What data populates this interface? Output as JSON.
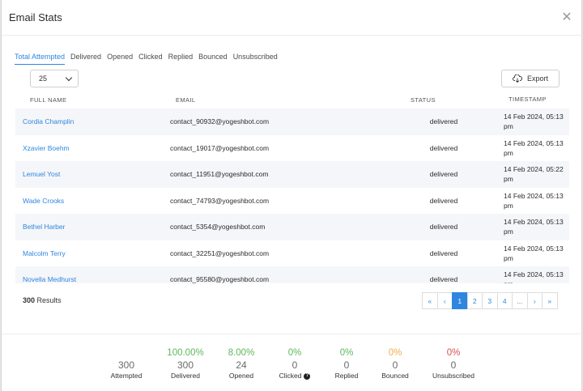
{
  "modal": {
    "title": "Email Stats"
  },
  "tabs": [
    "Total Attempted",
    "Delivered",
    "Opened",
    "Clicked",
    "Replied",
    "Bounced",
    "Unsubscribed"
  ],
  "page_size": {
    "selected": "25"
  },
  "export_label": "Export",
  "columns": [
    "FULL NAME",
    "EMAIL",
    "STATUS",
    "TIMESTAMP"
  ],
  "rows": [
    {
      "name": "Cordia Champlin",
      "email": "contact_90932@yogeshbot.com",
      "status": "delivered",
      "ts1": "14 Feb 2024, 05:13",
      "ts2": "pm"
    },
    {
      "name": "Xzavier Boehm",
      "email": "contact_19017@yogeshbot.com",
      "status": "delivered",
      "ts1": "14 Feb 2024, 05:13",
      "ts2": "pm"
    },
    {
      "name": "Lemuel Yost",
      "email": "contact_11951@yogeshbot.com",
      "status": "delivered",
      "ts1": "14 Feb 2024, 05:22",
      "ts2": "pm"
    },
    {
      "name": "Wade Crooks",
      "email": "contact_74793@yogeshbot.com",
      "status": "delivered",
      "ts1": "14 Feb 2024, 05:13",
      "ts2": "pm"
    },
    {
      "name": "Bethel Harber",
      "email": "contact_5354@yogeshbot.com",
      "status": "delivered",
      "ts1": "14 Feb 2024, 05:13",
      "ts2": "pm"
    },
    {
      "name": "Malcolm Terry",
      "email": "contact_32251@yogeshbot.com",
      "status": "delivered",
      "ts1": "14 Feb 2024, 05:13",
      "ts2": "pm"
    },
    {
      "name": "Novella Medhurst",
      "email": "contact_95580@yogeshbot.com",
      "status": "delivered",
      "ts1": "14 Feb 2024, 05:13",
      "ts2": "pm"
    }
  ],
  "results": {
    "count": "300",
    "label": "Results"
  },
  "pagination": {
    "first": "«",
    "prev": "‹",
    "pages": [
      "1",
      "2",
      "3",
      "4"
    ],
    "ellipsis": "...",
    "next": "›",
    "last": "»",
    "current": "1"
  },
  "stats": [
    {
      "pct": "",
      "count": "300",
      "label": "Attempted",
      "color": "#6b6b6b"
    },
    {
      "pct": "100.00%",
      "count": "300",
      "label": "Delivered",
      "color": "#5cb85c"
    },
    {
      "pct": "8.00%",
      "count": "24",
      "label": "Opened",
      "color": "#5cb85c"
    },
    {
      "pct": "0%",
      "count": "0",
      "label": "Clicked",
      "color": "#5cb85c"
    },
    {
      "pct": "0%",
      "count": "0",
      "label": "Replied",
      "color": "#5cb85c"
    },
    {
      "pct": "0%",
      "count": "0",
      "label": "Bounced",
      "color": "#f0ad4e"
    },
    {
      "pct": "0%",
      "count": "0",
      "label": "Unsubscribed",
      "color": "#d9534f"
    }
  ],
  "clicked_help": "?"
}
